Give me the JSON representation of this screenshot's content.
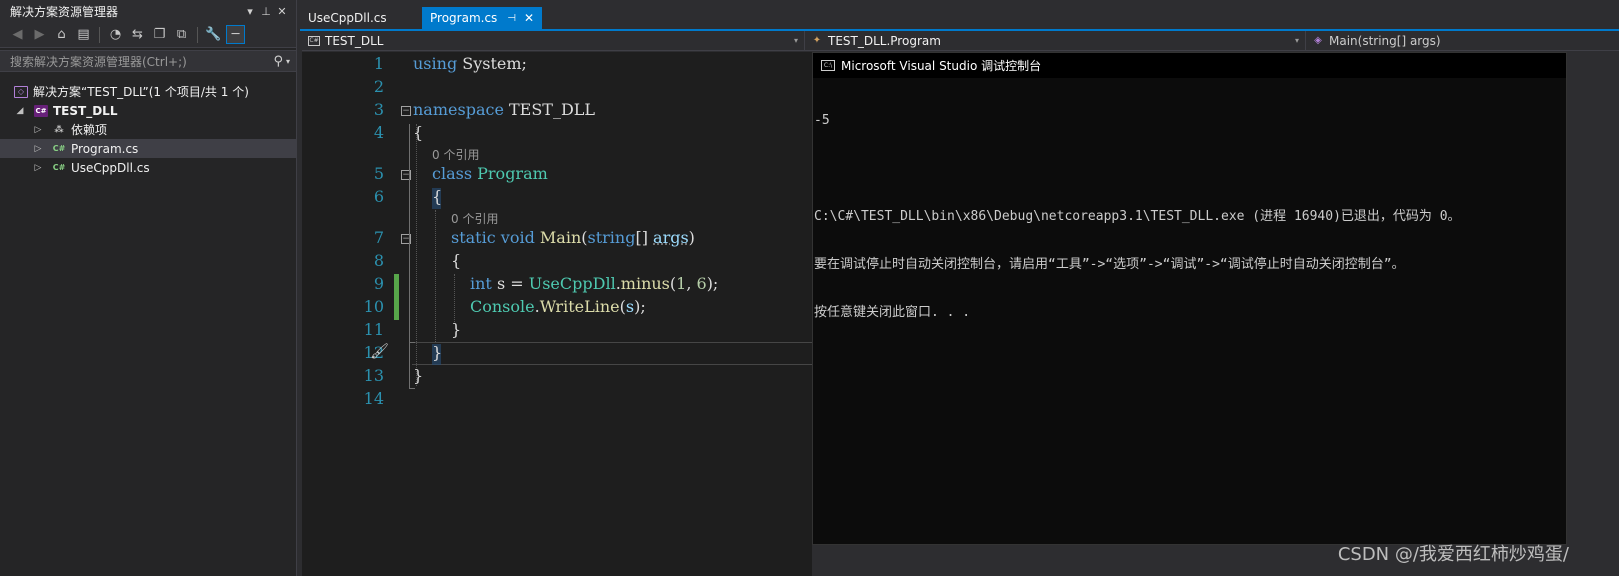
{
  "solution_explorer": {
    "title": "解决方案资源管理器",
    "search_placeholder": "搜索解决方案资源管理器(Ctrl+;)",
    "tree": {
      "solution": "解决方案“TEST_DLL”(1 个项目/共 1 个)",
      "project": "TEST_DLL",
      "dependencies": "依赖项",
      "file1": "Program.cs",
      "file2": "UseCppDll.cs"
    }
  },
  "tabs": [
    {
      "label": "UseCppDll.cs",
      "active": false
    },
    {
      "label": "Program.cs",
      "active": true
    }
  ],
  "navbar": {
    "project": "TEST_DLL",
    "class": "TEST_DLL.Program",
    "member": "Main(string[] args)"
  },
  "editor": {
    "line_numbers": [
      "1",
      "2",
      "3",
      "4",
      "5",
      "6",
      "7",
      "8",
      "9",
      "10",
      "11",
      "12",
      "13",
      "14"
    ],
    "refs": "0 个引用",
    "code": {
      "l1_kw": "using",
      "l1_rest": " System;",
      "l3_kw": "namespace",
      "l3_rest": " TEST_DLL",
      "l4": "{",
      "l5_kw": "class",
      "l5_ty": "Program",
      "l6": "{",
      "l7_kw1": "static",
      "l7_kw2": "void",
      "l7_mt": "Main",
      "l7_p1": "(",
      "l7_kw3": "string",
      "l7_p2": "[] ",
      "l7_pm": "args",
      "l7_p3": ")",
      "l8": "{",
      "l9_kw": "int",
      "l9_a": " s = ",
      "l9_ty": "UseCppDll",
      "l9_b": ".",
      "l9_mt": "minus",
      "l9_c": "(",
      "l9_n1": "1",
      "l9_d": ", ",
      "l9_n2": "6",
      "l9_e": ");",
      "l10_ty": "Console",
      "l10_a": ".",
      "l10_mt": "WriteLine",
      "l10_b": "(",
      "l10_pm": "s",
      "l10_c": ");",
      "l11": "}",
      "l12": "}",
      "l13": "}"
    }
  },
  "console": {
    "title": "Microsoft Visual Studio 调试控制台",
    "lines": [
      "-5",
      "",
      "C:\\C#\\TEST_DLL\\bin\\x86\\Debug\\netcoreapp3.1\\TEST_DLL.exe (进程 16940)已退出，代码为 0。",
      "要在调试停止时自动关闭控制台，请启用“工具”->“选项”->“调试”->“调试停止时自动关闭控制台”。",
      "按任意键关闭此窗口. . ."
    ]
  },
  "watermark": "CSDN @/我爱西红柿炒鸡蛋/"
}
